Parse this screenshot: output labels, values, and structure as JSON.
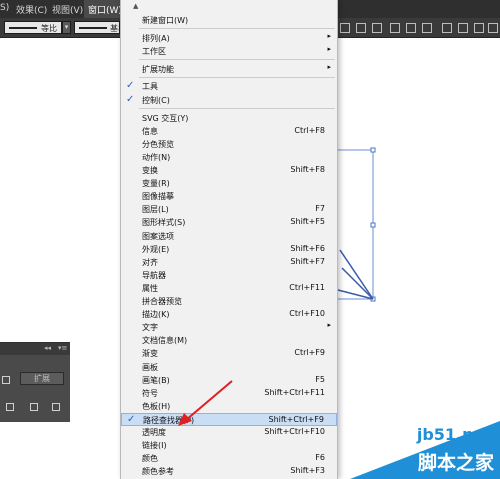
{
  "menubar": {
    "items": [
      {
        "label": "S)"
      },
      {
        "label": "效果(C)"
      },
      {
        "label": "视图(V)"
      },
      {
        "label": "窗口(W)"
      }
    ]
  },
  "toolbar": {
    "stroke1_label": "等比",
    "stroke2_label": "基本"
  },
  "panel": {
    "expand_label": "扩展"
  },
  "window_menu": {
    "items": [
      {
        "label": "新建窗口(W)",
        "shortcut": "",
        "submenu": false,
        "checked": false
      },
      {
        "label": "排列(A)",
        "shortcut": "",
        "submenu": true,
        "checked": false
      },
      {
        "label": "工作区",
        "shortcut": "",
        "submenu": true,
        "checked": false
      },
      {
        "label": "扩展功能",
        "shortcut": "",
        "submenu": true,
        "checked": false
      },
      {
        "label": "工具",
        "shortcut": "",
        "submenu": false,
        "checked": true
      },
      {
        "label": "控制(C)",
        "shortcut": "",
        "submenu": false,
        "checked": true
      },
      {
        "label": "SVG 交互(Y)",
        "shortcut": "",
        "submenu": false,
        "checked": false
      },
      {
        "label": "信息",
        "shortcut": "Ctrl+F8",
        "submenu": false,
        "checked": false
      },
      {
        "label": "分色预览",
        "shortcut": "",
        "submenu": false,
        "checked": false
      },
      {
        "label": "动作(N)",
        "shortcut": "",
        "submenu": false,
        "checked": false
      },
      {
        "label": "变换",
        "shortcut": "Shift+F8",
        "submenu": false,
        "checked": false
      },
      {
        "label": "变量(R)",
        "shortcut": "",
        "submenu": false,
        "checked": false
      },
      {
        "label": "图像描摹",
        "shortcut": "",
        "submenu": false,
        "checked": false
      },
      {
        "label": "图层(L)",
        "shortcut": "F7",
        "submenu": false,
        "checked": false
      },
      {
        "label": "图形样式(S)",
        "shortcut": "Shift+F5",
        "submenu": false,
        "checked": false
      },
      {
        "label": "图案选项",
        "shortcut": "",
        "submenu": false,
        "checked": false
      },
      {
        "label": "外观(E)",
        "shortcut": "Shift+F6",
        "submenu": false,
        "checked": false
      },
      {
        "label": "对齐",
        "shortcut": "Shift+F7",
        "submenu": false,
        "checked": false
      },
      {
        "label": "导航器",
        "shortcut": "",
        "submenu": false,
        "checked": false
      },
      {
        "label": "属性",
        "shortcut": "Ctrl+F11",
        "submenu": false,
        "checked": false
      },
      {
        "label": "拼合器预览",
        "shortcut": "",
        "submenu": false,
        "checked": false
      },
      {
        "label": "描边(K)",
        "shortcut": "Ctrl+F10",
        "submenu": false,
        "checked": false
      },
      {
        "label": "文字",
        "shortcut": "",
        "submenu": true,
        "checked": false
      },
      {
        "label": "文档信息(M)",
        "shortcut": "",
        "submenu": false,
        "checked": false
      },
      {
        "label": "渐变",
        "shortcut": "Ctrl+F9",
        "submenu": false,
        "checked": false
      },
      {
        "label": "画板",
        "shortcut": "",
        "submenu": false,
        "checked": false
      },
      {
        "label": "画笔(B)",
        "shortcut": "F5",
        "submenu": false,
        "checked": false
      },
      {
        "label": "符号",
        "shortcut": "Shift+Ctrl+F11",
        "submenu": false,
        "checked": false
      },
      {
        "label": "色板(H)",
        "shortcut": "",
        "submenu": false,
        "checked": false
      },
      {
        "label": "路径查找器(P)",
        "shortcut": "Shift+Ctrl+F9",
        "submenu": false,
        "checked": true
      },
      {
        "label": "透明度",
        "shortcut": "Shift+Ctrl+F10",
        "submenu": false,
        "checked": false
      },
      {
        "label": "链接(I)",
        "shortcut": "",
        "submenu": false,
        "checked": false
      },
      {
        "label": "颜色",
        "shortcut": "F6",
        "submenu": false,
        "checked": false
      },
      {
        "label": "颜色参考",
        "shortcut": "Shift+F3",
        "submenu": false,
        "checked": false
      }
    ]
  },
  "watermark": {
    "site": "jb51.net",
    "brand": "脚本之家"
  },
  "colors": {
    "menubar_bg": "#2f2f2f",
    "menu_bg": "#f1f1f1",
    "highlight": "#c9ddf5",
    "check": "#2a64c5",
    "arrow": "#e02020",
    "watermark": "#1f8fd7"
  }
}
